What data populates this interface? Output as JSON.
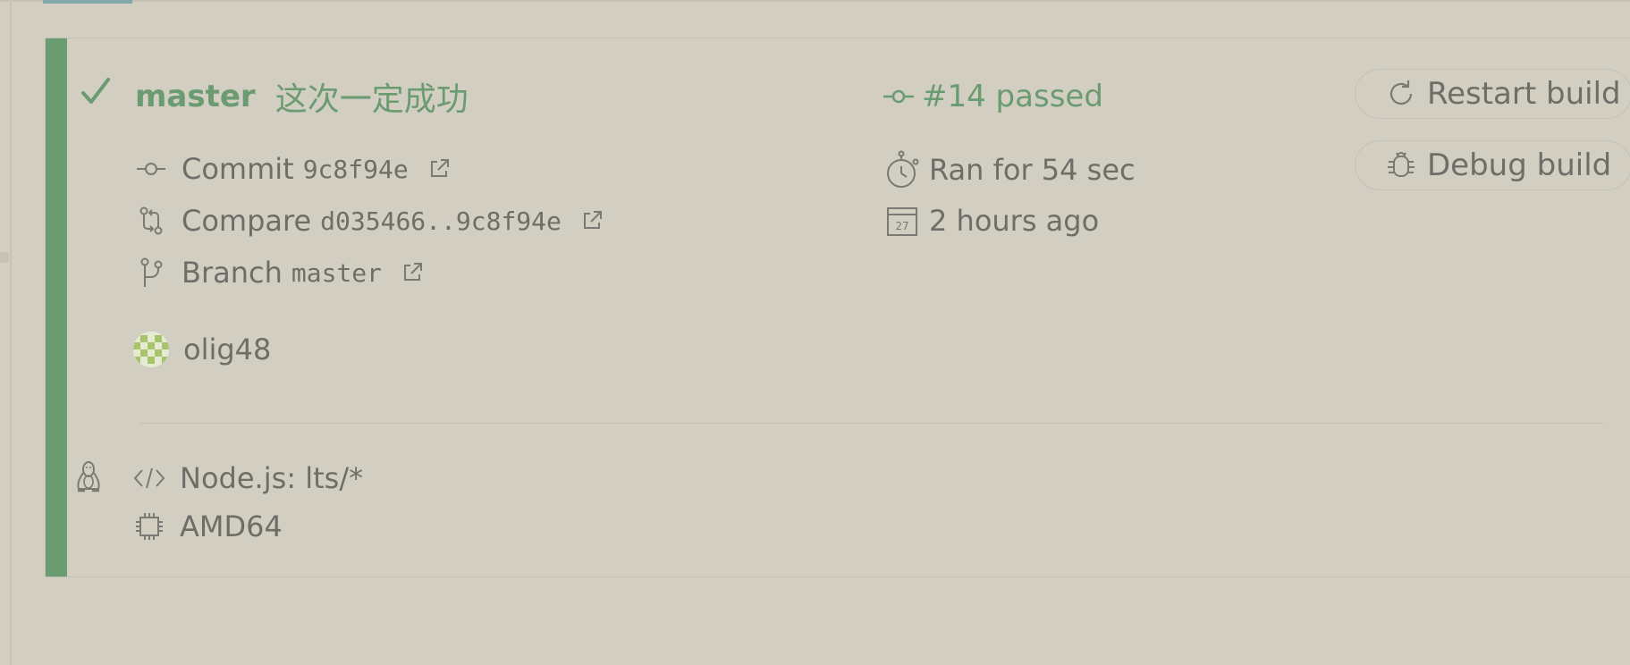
{
  "build": {
    "branch": "master",
    "message": "这次一定成功",
    "status": "#14 passed",
    "commit_label": "Commit",
    "commit_sha": "9c8f94e",
    "compare_label": "Compare",
    "compare_range": "d035466..9c8f94e",
    "branch_label": "Branch",
    "branch_value": "master",
    "duration": "Ran for 54 sec",
    "finished": "2 hours ago",
    "calendar_day": "27",
    "author": "olig48"
  },
  "actions": {
    "restart": "Restart build",
    "debug": "Debug build"
  },
  "config": {
    "language": "Node.js: lts/*",
    "arch": "AMD64"
  },
  "colors": {
    "background": "#d2cec2",
    "passed_green": "#6b9b71",
    "text_gray": "#6e6e69",
    "border": "#c4c0b4"
  },
  "icons": {
    "status": "check-icon",
    "commit": "commit-icon",
    "compare": "compare-icon",
    "branch": "branch-icon",
    "external": "external-link-icon",
    "duration": "stopwatch-icon",
    "date": "calendar-icon",
    "restart": "restart-icon",
    "debug": "bug-icon",
    "os": "linux-icon",
    "language": "code-icon",
    "arch": "cpu-icon"
  }
}
